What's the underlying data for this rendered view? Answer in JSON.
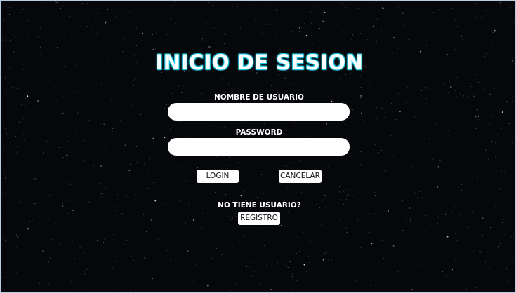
{
  "login": {
    "title": "INICIO DE SESION",
    "username_label": "NOMBRE DE USUARIO",
    "username_value": "",
    "password_label": "PASSWORD",
    "password_value": "",
    "login_button": "LOGIN",
    "cancel_button": "CANCELAR",
    "no_account_text": "NO TIENE USUARIO?",
    "register_button": "REGISTRO"
  },
  "theme": {
    "background": "#06070b",
    "title_glow": "#22d3ee",
    "text": "#ffffff"
  }
}
